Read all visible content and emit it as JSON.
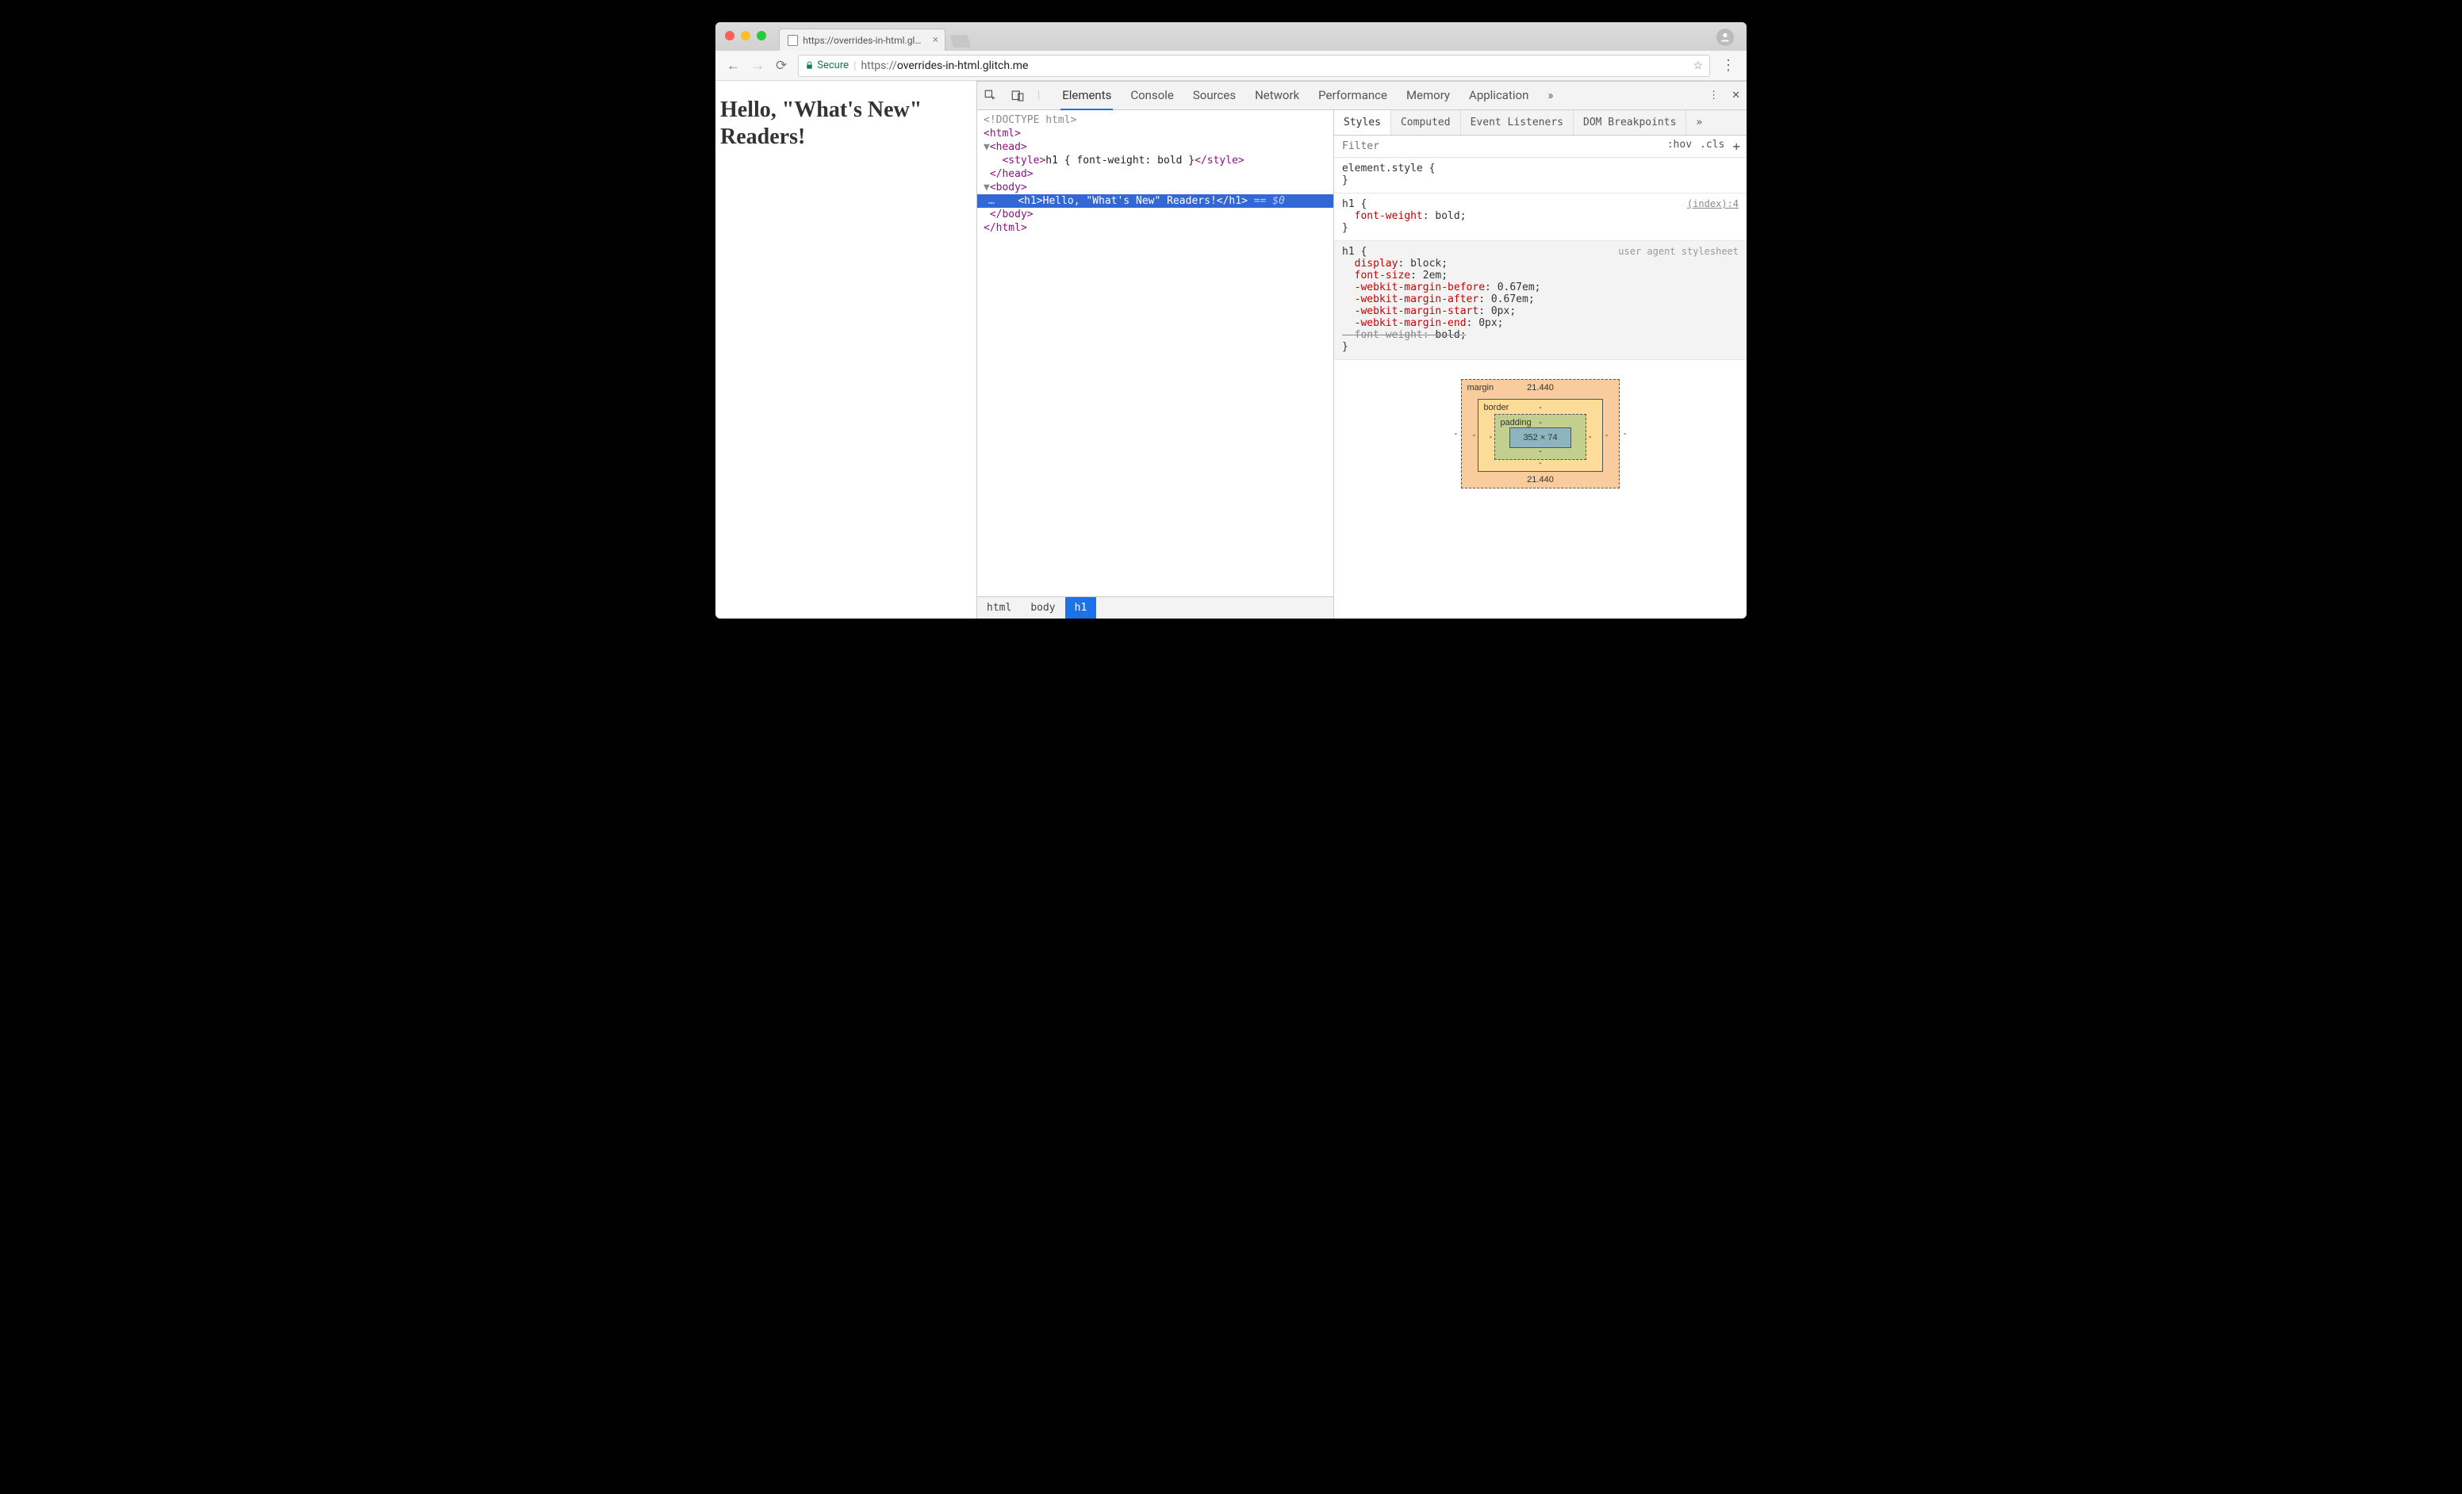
{
  "browser": {
    "tab_title": "https://overrides-in-html.glitch",
    "secure_label": "Secure",
    "url_scheme": "https://",
    "url_host": "overrides-in-html.glitch.me",
    "url_path": ""
  },
  "page": {
    "h1": "Hello, \"What's New\" Readers!"
  },
  "devtools": {
    "tabs": [
      "Elements",
      "Console",
      "Sources",
      "Network",
      "Performance",
      "Memory",
      "Application"
    ],
    "active_tab": "Elements",
    "overflow": "»",
    "menu": "⋮",
    "close": "✕"
  },
  "dom": {
    "doctype": "<!DOCTYPE html>",
    "html_open": "<html>",
    "head_open": "<head>",
    "style_line_open": "<style>",
    "style_line_css": "h1 { font-weight: bold }",
    "style_line_close": "</style>",
    "head_close": "</head>",
    "body_open": "<body>",
    "h1_open": "<h1>",
    "h1_text": "Hello, \"What's New\" Readers!",
    "h1_close": "</h1>",
    "eq0": "== $0",
    "body_close": "</body>",
    "html_close": "</html>",
    "ellipsis": "…"
  },
  "crumbs": [
    "html",
    "body",
    "h1"
  ],
  "styles": {
    "tabs": [
      "Styles",
      "Computed",
      "Event Listeners",
      "DOM Breakpoints"
    ],
    "overflow": "»",
    "filter_placeholder": "Filter",
    "hov": ":hov",
    "cls": ".cls",
    "plus": "+",
    "rules": {
      "r0_selector": "element.style {",
      "r0_close": "}",
      "r1_selector": "h1 {",
      "r1_src": "(index):4",
      "r1_p1_prop": "font-weight",
      "r1_p1_val": "bold;",
      "r1_close": "}",
      "r2_selector": "h1 {",
      "r2_label": "user agent stylesheet",
      "r2_p1_prop": "display",
      "r2_p1_val": "block;",
      "r2_p2_prop": "font-size",
      "r2_p2_val": "2em;",
      "r2_p3_prop": "-webkit-margin-before",
      "r2_p3_val": "0.67em;",
      "r2_p4_prop": "-webkit-margin-after",
      "r2_p4_val": "0.67em;",
      "r2_p5_prop": "-webkit-margin-start",
      "r2_p5_val": "0px;",
      "r2_p6_prop": "-webkit-margin-end",
      "r2_p6_val": "0px;",
      "r2_p7_prop": "font-weight",
      "r2_p7_val": "bold;",
      "r2_close": "}"
    }
  },
  "boxmodel": {
    "margin_label": "margin",
    "margin_top": "21.440",
    "margin_bottom": "21.440",
    "margin_side": "-",
    "border_label": "border",
    "border_val": "-",
    "padding_label": "padding",
    "padding_val": "-",
    "content": "352 × 74"
  }
}
